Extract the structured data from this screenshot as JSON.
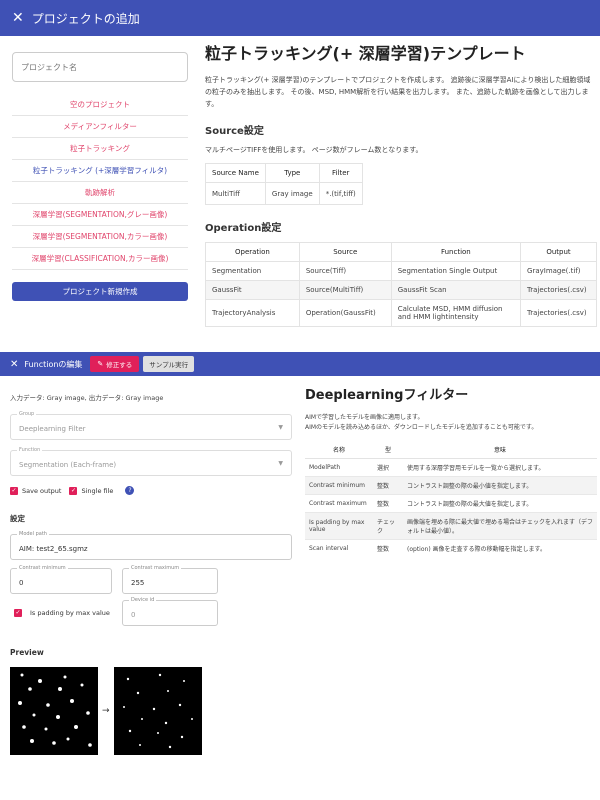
{
  "top": {
    "title": "プロジェクトの追加",
    "name_placeholder": "プロジェクト名",
    "templates": [
      {
        "label": "空のプロジェクト",
        "selected": false
      },
      {
        "label": "メディアンフィルター",
        "selected": false
      },
      {
        "label": "粒子トラッキング",
        "selected": false
      },
      {
        "label": "粒子トラッキング (+深層学習フィルタ)",
        "selected": true
      },
      {
        "label": "軌跡解析",
        "selected": false
      },
      {
        "label": "深層学習(SEGMENTATION,グレー画像)",
        "selected": false
      },
      {
        "label": "深層学習(SEGMENTATION,カラー画像)",
        "selected": false
      },
      {
        "label": "深層学習(CLASSIFICATION,カラー画像)",
        "selected": false
      }
    ],
    "create_button": "プロジェクト新規作成",
    "detail": {
      "title": "粒子トラッキング(+ 深層学習)テンプレート",
      "description": "粒子トラッキング(+ 深層学習)のテンプレートでプロジェクトを作成します。 追跡後に深層学習AIにより検出した細胞領域の粒子のみを抽出します。 その後、MSD, HMM解析を行い結果を出力します。 また、追跡した軌跡を画像として出力します。",
      "source_heading": "Source設定",
      "source_desc": "マルチページTIFFを使用します。 ページ数がフレーム数となります。",
      "source_headers": [
        "Source Name",
        "Type",
        "Filter"
      ],
      "source_rows": [
        [
          "MultiTiff",
          "Gray image",
          "*.(tif,tiff)"
        ]
      ],
      "op_heading": "Operation設定",
      "op_headers": [
        "Operation",
        "Source",
        "Function",
        "Output"
      ],
      "op_rows": [
        [
          "Segmentation",
          "Source(Tiff)",
          "Segmentation Single Output",
          "GrayImage(.tif)"
        ],
        [
          "GaussFit",
          "Source(MultiTiff)",
          "GaussFit Scan",
          "Trajectories(.csv)"
        ],
        [
          "TrajectoryAnalysis",
          "Operation(GaussFit)",
          "Calculate MSD, HMM diffusion and HMM lightintensity",
          "Trajectories(.csv)"
        ]
      ]
    }
  },
  "bottom": {
    "title": "Functionの編集",
    "fix_button": "修正する",
    "run_button": "サンプル実行",
    "io_text": "入力データ: Gray image, 出力データ: Gray image",
    "group_label": "Group",
    "group_value": "Deeplearning Filter",
    "function_label": "Function",
    "function_value": "Segmentation (Each-frame)",
    "save_output_label": "Save output",
    "single_file_label": "Single file",
    "settings_heading": "設定",
    "model_path_label": "Model path",
    "model_path_value": "AIM: test2_65.sgmz",
    "contrast_min_label": "Contrast minimum",
    "contrast_min_value": "0",
    "contrast_max_label": "Contrast maximum",
    "contrast_max_value": "255",
    "padding_label": "Is padding by max value",
    "device_label": "Device id",
    "device_value": "0",
    "preview_heading": "Preview",
    "help_title": "Deeplearningフィルター",
    "help_desc_1": "AIMで学習したモデルを画像に適用します。",
    "help_desc_2": "AIMのモデルを読み込めるほか、ダウンロードしたモデルを追加することも可能です。",
    "help_headers": [
      "名称",
      "型",
      "意味"
    ],
    "help_rows": [
      [
        "ModelPath",
        "選択",
        "使用する深層学習用モデルを一覧から選択します。"
      ],
      [
        "Contrast minimum",
        "整数",
        "コントラスト調整の際の最小値を指定します。"
      ],
      [
        "Contrast maximum",
        "整数",
        "コントラスト調整の際の最大値を指定します。"
      ],
      [
        "Is padding by max value",
        "チェック",
        "画像端を埋める際に最大値で埋める場合はチェックを入れます（デフォルトは最小値）。"
      ],
      [
        "Scan interval",
        "整数",
        "(option) 画像を走査する際の移動幅を指定します。"
      ]
    ]
  },
  "colors": {
    "primary": "#3f51b5",
    "accent": "#e0205a",
    "template_link": "#e0446b"
  },
  "icons": {
    "close": "close-icon",
    "pencil": "pencil-icon",
    "help": "help-icon",
    "arrow": "arrow-right-icon",
    "dropdown": "dropdown-arrow-icon"
  }
}
